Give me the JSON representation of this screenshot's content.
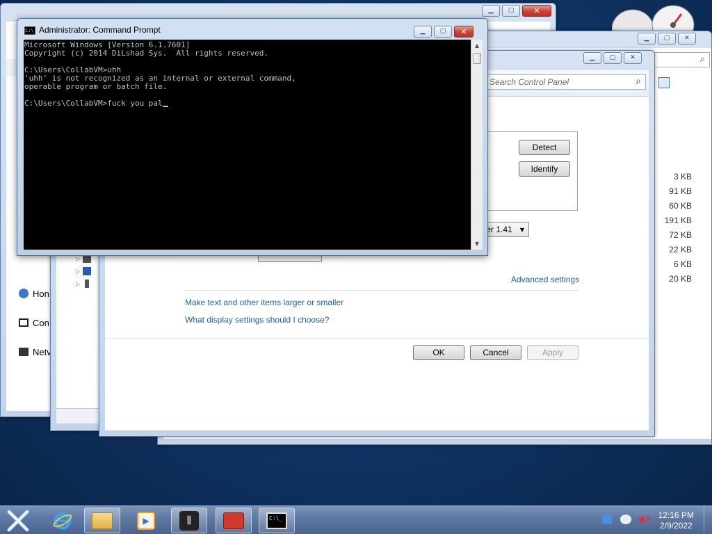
{
  "cmd": {
    "title": "Administrator: Command Prompt",
    "lines": [
      "Microsoft Windows [Version 6.1.7601]",
      "Copyright (c) 2014 DiLshad Sys.  All rights reserved.",
      "",
      "C:\\Users\\CollabVM>uhh",
      "'uhh' is not recognized as an internal or external command,",
      "operable program or batch file.",
      "",
      "C:\\Users\\CollabVM>fuck you pal"
    ]
  },
  "control_panel": {
    "search_placeholder": "Search Control Panel"
  },
  "display_settings": {
    "detect_label": "Detect",
    "identify_label": "Identify",
    "monitor_value": "ter 1.41",
    "advanced_link": "Advanced settings",
    "link_larger": "Make text and other items larger or smaller",
    "link_choose": "What display settings should I choose?",
    "ok_label": "OK",
    "cancel_label": "Cancel",
    "apply_label": "Apply"
  },
  "file_sizes": [
    "3 KB",
    "91 KB",
    "60 KB",
    "191 KB",
    "72 KB",
    "22 KB",
    "6 KB",
    "20 KB"
  ],
  "nav_items": [
    "Hon",
    "Con",
    "Netv"
  ],
  "taskbar": {
    "time": "12:16 PM",
    "date": "2/9/2022"
  },
  "colors": {
    "console_bg": "#000000",
    "console_fg": "#c0c0c0",
    "link": "#1e5fa8",
    "taskbar": "#5f7aa4"
  }
}
